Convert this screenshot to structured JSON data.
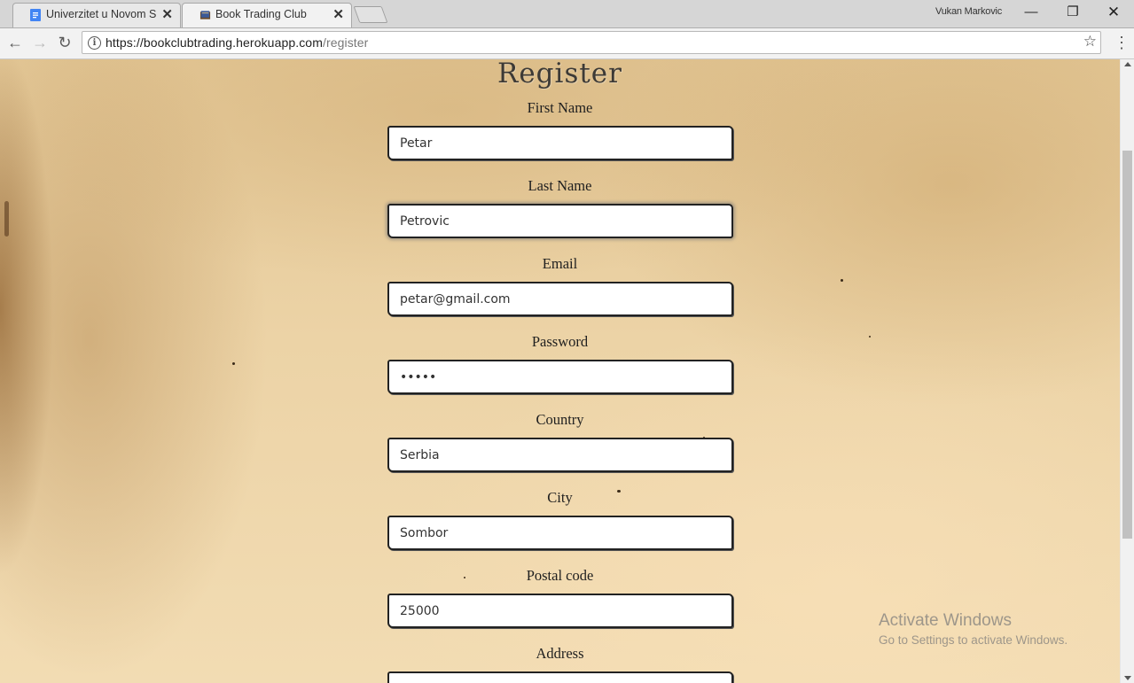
{
  "tabs": [
    {
      "title": "Univerzitet u Novom Sad",
      "active": false,
      "favicon": "google-docs-icon"
    },
    {
      "title": "Book Trading Club",
      "active": true,
      "favicon": "book-icon"
    }
  ],
  "window": {
    "user": "Vukan Markovic"
  },
  "address_bar": {
    "url_host": "https://bookclubtrading.herokuapp.com",
    "url_path": "/register"
  },
  "form": {
    "title": "Register",
    "fields": [
      {
        "label": "First Name",
        "value": "Petar",
        "focused": false
      },
      {
        "label": "Last Name",
        "value": "Petrovic",
        "focused": true
      },
      {
        "label": "Email",
        "value": "petar@gmail.com",
        "focused": false
      },
      {
        "label": "Password",
        "value": "•••••",
        "focused": false
      },
      {
        "label": "Country",
        "value": "Serbia",
        "focused": false
      },
      {
        "label": "City",
        "value": "Sombor",
        "focused": false
      },
      {
        "label": "Postal code",
        "value": "25000",
        "focused": false
      },
      {
        "label": "Address",
        "value": "",
        "focused": false
      }
    ]
  },
  "watermark": {
    "title": "Activate Windows",
    "subtitle": "Go to Settings to activate Windows."
  },
  "colors": {
    "accent": "#3d3a36",
    "paper": "#ecd3a6"
  }
}
